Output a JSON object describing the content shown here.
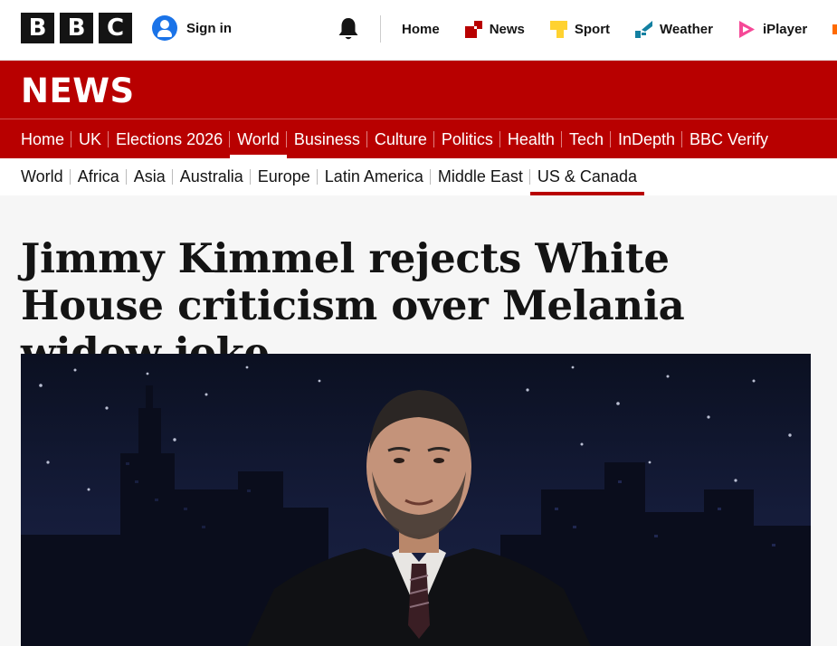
{
  "header": {
    "logo_letters": [
      "B",
      "B",
      "C"
    ],
    "sign_in_label": "Sign in",
    "global_nav": [
      {
        "label": "Home",
        "icon": "none"
      },
      {
        "label": "News",
        "icon": "news-icon"
      },
      {
        "label": "Sport",
        "icon": "sport-icon"
      },
      {
        "label": "Weather",
        "icon": "weather-icon"
      },
      {
        "label": "iPlayer",
        "icon": "iplayer-icon"
      }
    ]
  },
  "news_bar": {
    "wordmark": "NEWS",
    "primary_nav": [
      "Home",
      "UK",
      "Elections 2026",
      "World",
      "Business",
      "Culture",
      "Politics",
      "Health",
      "Tech",
      "InDepth",
      "BBC Verify"
    ],
    "primary_active": "World"
  },
  "secondary_nav": {
    "items": [
      "World",
      "Africa",
      "Asia",
      "Australia",
      "Europe",
      "Latin America",
      "Middle East",
      "US & Canada"
    ],
    "active": "US & Canada"
  },
  "article": {
    "headline": "Jimmy Kimmel rejects White House criticism over Melania widow joke",
    "image_description_icon": "hero-photo"
  },
  "colors": {
    "bbc_red": "#b80000",
    "text": "#141414",
    "signin_blue": "#1a73e8",
    "sport_yellow": "#ffd230",
    "weather_blue": "#1380a1",
    "iplayer_pink": "#f54997"
  }
}
